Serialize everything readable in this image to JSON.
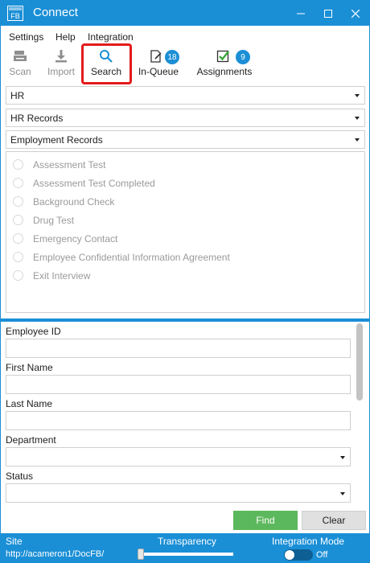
{
  "app": {
    "title": "Connect",
    "logo_text": "FB"
  },
  "menu": [
    "Settings",
    "Help",
    "Integration"
  ],
  "toolbar": {
    "scan": "Scan",
    "import": "Import",
    "search": "Search",
    "in_queue": "In-Queue",
    "in_queue_count": "18",
    "assignments": "Assignments",
    "assignments_count": "9"
  },
  "filters": {
    "department": "HR",
    "cabinet": "HR Records",
    "document_type": "Employment Records"
  },
  "documents": [
    "Assessment Test",
    "Assessment Test Completed",
    "Background Check",
    "Drug Test",
    "Emergency Contact",
    "Employee Confidential Information Agreement",
    "Exit Interview"
  ],
  "form": {
    "employee_id_label": "Employee ID",
    "employee_id_value": "",
    "first_name_label": "First Name",
    "first_name_value": "",
    "last_name_label": "Last Name",
    "last_name_value": "",
    "department_label": "Department",
    "department_value": "",
    "status_label": "Status",
    "status_value": ""
  },
  "buttons": {
    "find": "Find",
    "clear": "Clear"
  },
  "status": {
    "site_label": "Site",
    "site_url": "http://acameron1/DocFB/",
    "transparency_label": "Transparency",
    "transparency_value": 0,
    "integration_label": "Integration Mode",
    "integration_state": "Off"
  },
  "colors": {
    "accent": "#1b8fd6",
    "find": "#5cb85c",
    "highlight": "#e31b1b"
  }
}
